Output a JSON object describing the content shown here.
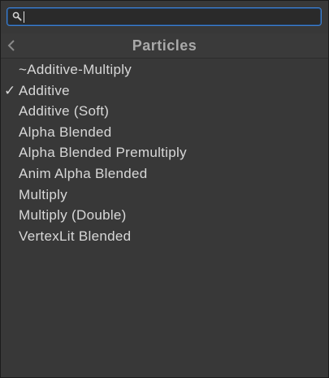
{
  "search": {
    "value": "",
    "placeholder": ""
  },
  "header": {
    "title": "Particles"
  },
  "list": {
    "items": [
      {
        "label": "~Additive-Multiply",
        "checked": false
      },
      {
        "label": "Additive",
        "checked": true
      },
      {
        "label": "Additive (Soft)",
        "checked": false
      },
      {
        "label": "Alpha Blended",
        "checked": false
      },
      {
        "label": "Alpha Blended Premultiply",
        "checked": false
      },
      {
        "label": "Anim Alpha Blended",
        "checked": false
      },
      {
        "label": "Multiply",
        "checked": false
      },
      {
        "label": "Multiply (Double)",
        "checked": false
      },
      {
        "label": "VertexLit Blended",
        "checked": false
      }
    ],
    "check_glyph": "✓"
  },
  "colors": {
    "background": "#383838",
    "search_border": "#3d7fcf",
    "text": "#d8d8d8",
    "header_text": "#a9a9a9"
  },
  "icons": {
    "search": "search-icon",
    "back": "chevron-left-icon",
    "check": "check-icon"
  }
}
